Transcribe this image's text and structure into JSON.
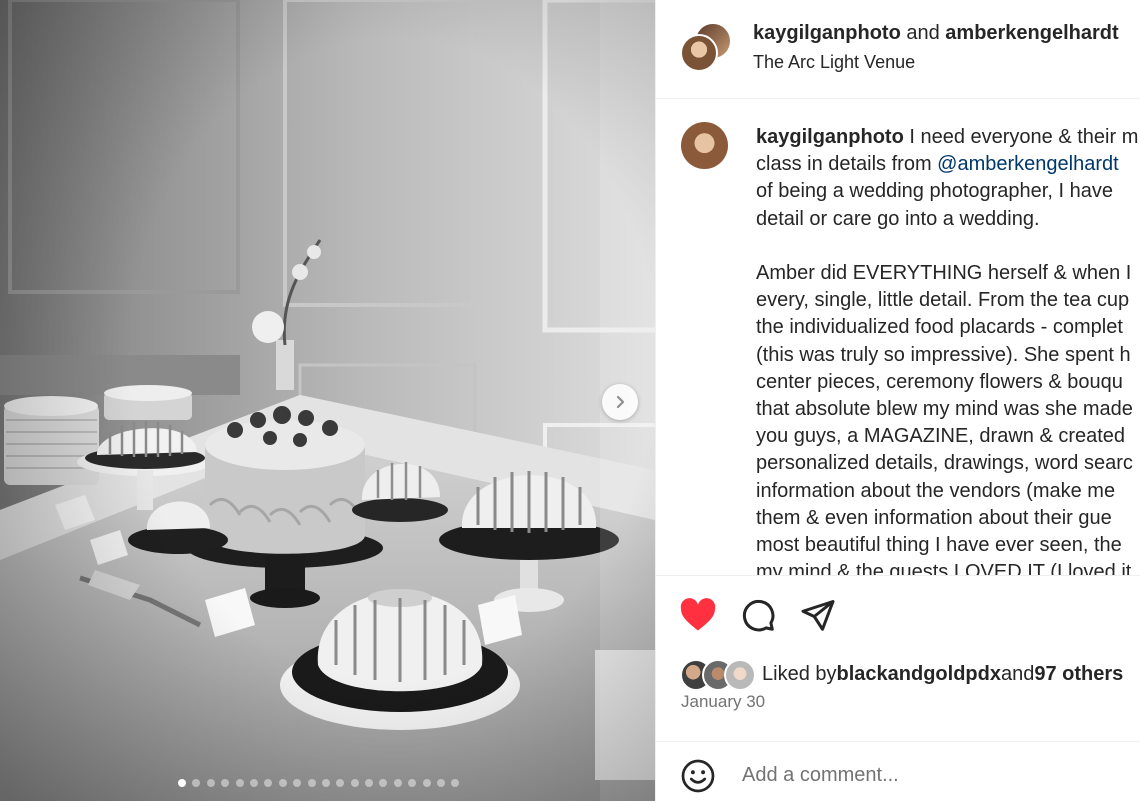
{
  "post": {
    "header": {
      "author": "kaygilganphoto",
      "connector": " and ",
      "coauthor": "amberkengelhardt",
      "location": "The Arc Light Venue"
    },
    "caption": {
      "username": "kaygilganphoto",
      "lines": [
        " I need everyone & their m",
        "class in details from ",
        "of being a wedding photographer, I have",
        "detail or care go into a wedding.",
        "",
        "Amber did EVERYTHING herself & when I",
        "every, single, little detail. From the tea cup",
        "the individualized food placards - complet",
        "(this was truly so impressive). She spent h",
        "center pieces, ceremony flowers & bouqu",
        "that absolute blew my mind was she made",
        "you guys, a MAGAZINE, drawn & created",
        "personalized details, drawings, word searc",
        "information about the vendors (make me",
        "them & even information about their gue",
        "most beautiful thing I have ever seen, the",
        "my mind & the guests LOVED IT (I loved it"
      ],
      "mention": "@amberkengelhardt"
    },
    "likes": {
      "prefix": "Liked by ",
      "user": "blackandgoldpdx",
      "middle": " and ",
      "others": "97 others"
    },
    "date": "January 30",
    "comment_box": {
      "placeholder": "Add a comment..."
    },
    "carousel": {
      "total": 20,
      "active_index": 0
    },
    "icons": {
      "like": "heart-filled-icon",
      "comment": "comment-bubble-icon",
      "share": "paper-plane-icon",
      "emoji": "smiley-emoji-icon",
      "next": "chevron-right-icon"
    },
    "colors": {
      "like_red": "#ff3040",
      "mention_blue": "#00376b",
      "secondary_text": "#737373"
    }
  }
}
